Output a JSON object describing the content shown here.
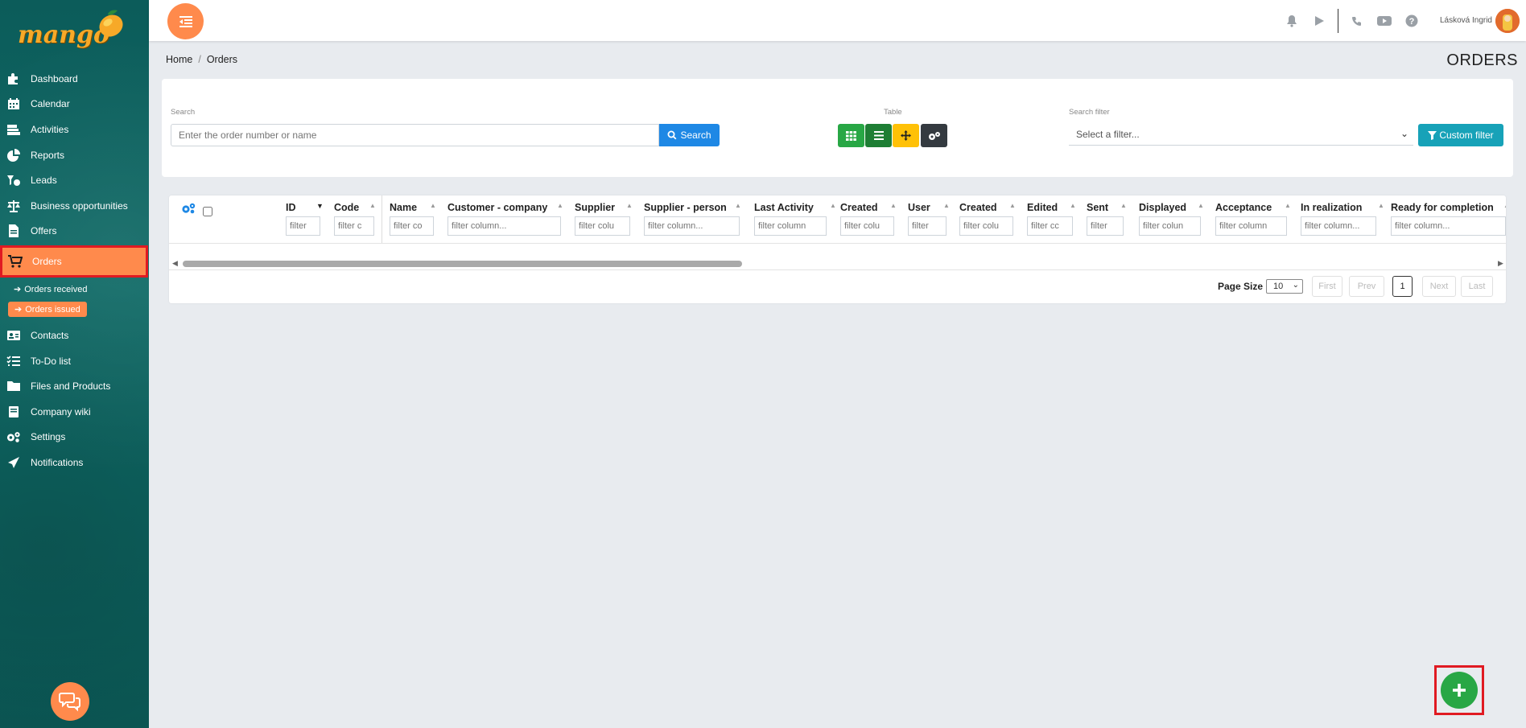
{
  "app": {
    "logo_text": "mango",
    "user_name": "Lásková Ingrid"
  },
  "sidebar": {
    "items": [
      {
        "label": "Dashboard",
        "icon": "puzzle-icon"
      },
      {
        "label": "Calendar",
        "icon": "calendar-icon"
      },
      {
        "label": "Activities",
        "icon": "activities-icon"
      },
      {
        "label": "Reports",
        "icon": "pie-chart-icon"
      },
      {
        "label": "Leads",
        "icon": "leads-icon"
      },
      {
        "label": "Business opportunities",
        "icon": "scale-icon"
      },
      {
        "label": "Offers",
        "icon": "document-icon"
      },
      {
        "label": "Orders",
        "icon": "cart-icon",
        "active": true
      },
      {
        "label": "Contacts",
        "icon": "address-card-icon"
      },
      {
        "label": "To-Do list",
        "icon": "tasks-icon"
      },
      {
        "label": "Files and Products",
        "icon": "folder-icon"
      },
      {
        "label": "Company wiki",
        "icon": "book-icon"
      },
      {
        "label": "Settings",
        "icon": "gears-icon"
      },
      {
        "label": "Notifications",
        "icon": "paper-plane-icon"
      }
    ],
    "orders_sub": [
      {
        "label": "Orders received"
      },
      {
        "label": "Orders issued",
        "active": true
      }
    ]
  },
  "breadcrumb": {
    "home": "Home",
    "sep": "/",
    "current": "Orders"
  },
  "page_title": "ORDERS",
  "filters": {
    "search_label": "Search",
    "search_placeholder": "Enter the order number or name",
    "search_button": "Search",
    "table_label": "Table",
    "search_filter_label": "Search filter",
    "search_filter_value": "Select a filter...",
    "custom_filter_button": "Custom filter"
  },
  "table": {
    "columns": [
      {
        "label": "ID",
        "filter": "filter"
      },
      {
        "label": "Code",
        "filter": "filter c"
      },
      {
        "label": "Name",
        "filter": "filter co"
      },
      {
        "label": "Customer - company",
        "filter": "filter column..."
      },
      {
        "label": "Supplier",
        "filter": "filter colu"
      },
      {
        "label": "Supplier - person",
        "filter": "filter column..."
      },
      {
        "label": "Last Activity",
        "filter": "filter column"
      },
      {
        "label": "Created",
        "filter": "filter colu"
      },
      {
        "label": "User",
        "filter": "filter"
      },
      {
        "label": "Created",
        "filter": "filter colu"
      },
      {
        "label": "Edited",
        "filter": "filter cc"
      },
      {
        "label": "Sent",
        "filter": "filter"
      },
      {
        "label": "Displayed",
        "filter": "filter colun"
      },
      {
        "label": "Acceptance",
        "filter": "filter column"
      },
      {
        "label": "In realization",
        "filter": "filter column..."
      },
      {
        "label": "Ready for completion",
        "filter": "filter column..."
      }
    ],
    "page_size_label": "Page Size",
    "page_size_value": "10",
    "pager": {
      "first": "First",
      "prev": "Prev",
      "current": "1",
      "next": "Next",
      "last": "Last"
    }
  },
  "colors": {
    "accent": "#ff8a4c",
    "highlight": "#e01a22",
    "sidebar_bg": "#0c5c5a",
    "primary": "#1e88e5",
    "success": "#28a745",
    "info": "#17a2b8",
    "warning": "#ffc107",
    "dark": "#343a40"
  }
}
